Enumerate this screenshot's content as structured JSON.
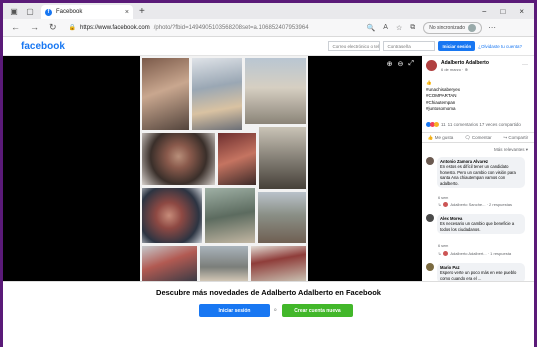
{
  "browser": {
    "tab_title": "Facebook",
    "new_tab_symbol": "+",
    "close_symbol": "×",
    "url_host": "https://www.facebook.com",
    "url_rest": "/photo/?fbid=1494905103568208set=a.106852407953964",
    "sync_label": "No sincronizado",
    "window_controls": [
      "−",
      "□",
      "×"
    ]
  },
  "fb_header": {
    "logo": "facebook",
    "email_placeholder": "Correo electrónico o tel",
    "password_placeholder": "Contraseña",
    "login_button": "Iniciar sesión",
    "forgot_link": "¿Olvidaste tu cuenta?"
  },
  "post": {
    "author": "Adalberto Adalberto",
    "date": "6 de marzo · ⊕",
    "tags": [
      "👍",
      "#unachisaberyex",
      "#COMPARTAN",
      "#Chiautempan",
      "#juntosomoma"
    ],
    "reactions_count": "11",
    "comments_shares": "11 comentarios  17 veces compartido",
    "actions": [
      "Me gusta",
      "Comentar",
      "Compartir"
    ],
    "sort_label": "Más relevantes ▾"
  },
  "comments": [
    {
      "author": "Antonio Zamora Alvarez",
      "text": "En estos es difícil tener un candidato honesto. Pero un cambio con visión para santa Ana chiautempan vamos con adalberto.",
      "meta": "6 sem",
      "reply": "Adalberto Sanche... · 2 respuestas"
    },
    {
      "author": "Alex Morea",
      "text": "Es necesario un cambio que beneficie a todos los ciudadanos.",
      "meta": "6 sem",
      "reply": "Adalberto Adalbert... · 1 respuesta"
    },
    {
      "author": "Mario Paz",
      "text": "Espero verte un poco más en ese pueblo como cuando era el ...",
      "meta": "",
      "reply": ""
    }
  ],
  "bottom": {
    "title": "Descubre más novedades de Adalberto Adalberto en Facebook",
    "login_button": "Iniciar sesión",
    "or_label": "o",
    "create_button": "Crear cuenta nueva"
  },
  "colors": {
    "facebook_blue": "#1877f2",
    "create_green": "#42b72a",
    "frame_purple": "#5a1a78"
  }
}
